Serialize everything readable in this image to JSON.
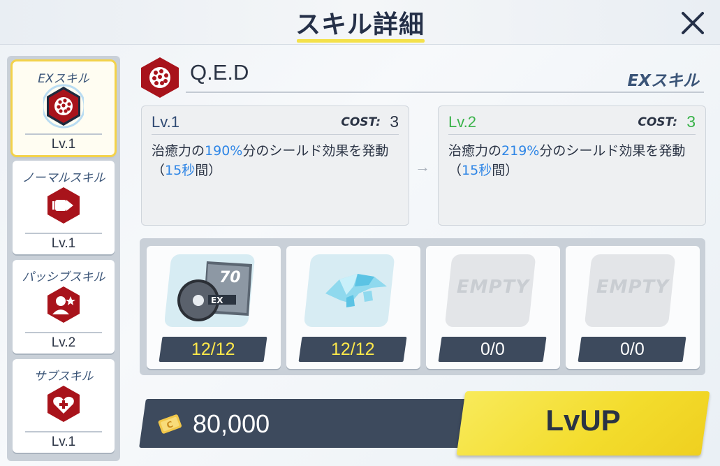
{
  "header": {
    "title": "スキル詳細"
  },
  "sidebar": {
    "items": [
      {
        "label": "EXスキル",
        "level": "Lv.1",
        "icon": "dotted-sphere-icon",
        "selected": true
      },
      {
        "label": "ノーマルスキル",
        "level": "Lv.1",
        "icon": "bullet-arrow-icon",
        "selected": false
      },
      {
        "label": "パッシブスキル",
        "level": "Lv.2",
        "icon": "person-star-icon",
        "selected": false
      },
      {
        "label": "サブスキル",
        "level": "Lv.1",
        "icon": "heart-cross-icon",
        "selected": false
      }
    ]
  },
  "skill": {
    "name": "Q.E.D",
    "type": "EXスキル",
    "current": {
      "level": "Lv.1",
      "cost_label": "COST:",
      "cost": "3",
      "desc_parts": [
        "治癒力の",
        "190%",
        "分のシールド効果を発動（",
        "15秒",
        "間）"
      ]
    },
    "next": {
      "level": "Lv.2",
      "cost_label": "COST:",
      "cost": "3",
      "desc_parts": [
        "治癒力の",
        "219%",
        "分のシールド効果を発動（",
        "15秒",
        "間）"
      ]
    }
  },
  "materials": [
    {
      "count": "12/12",
      "icon": "ex-disc-icon",
      "empty_text": ""
    },
    {
      "count": "12/12",
      "icon": "crystal-fragment-icon",
      "empty_text": ""
    },
    {
      "count": "0/0",
      "icon": "empty-slot",
      "empty_text": "EMPTY"
    },
    {
      "count": "0/0",
      "icon": "empty-slot",
      "empty_text": "EMPTY"
    }
  ],
  "footer": {
    "credit_amount": "80,000",
    "lvup_label": "LvUP"
  },
  "colors": {
    "accent_yellow": "#f4e14a",
    "highlight_blue": "#2f86e6",
    "next_green": "#3ab34a",
    "skill_red": "#a8131b"
  }
}
